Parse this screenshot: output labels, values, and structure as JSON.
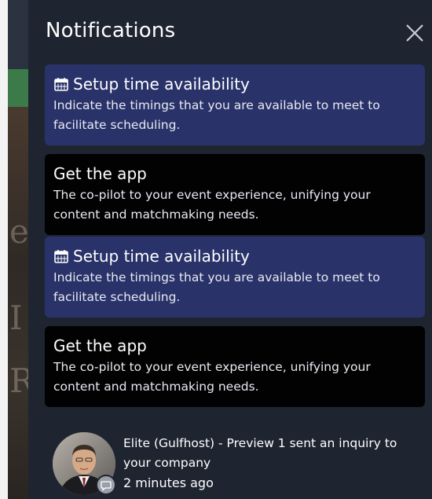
{
  "panel": {
    "title": "Notifications",
    "close_icon": "close-icon"
  },
  "notifications": [
    {
      "title": "Setup time availability",
      "body": "Indicate the timings that you are available to meet to facilitate scheduling.",
      "icon": "calendar-icon",
      "color": "#29336a"
    },
    {
      "title": "Get the app",
      "body": "The co-pilot to your event experience, unifying your content and matchmaking needs.",
      "color": "#020203"
    },
    {
      "title": "Setup time availability",
      "body": "Indicate the timings that you are available to meet to facilitate scheduling.",
      "icon": "calendar-icon",
      "color": "#29336a"
    },
    {
      "title": "Get the app",
      "body": "The co-pilot to your event experience, unifying your content and matchmaking needs.",
      "color": "#020203"
    }
  ],
  "inquiry": {
    "message": "Elite (Gulfhost) - Preview 1 sent an inquiry to your company",
    "time": "2 minutes ago",
    "badge_icon": "chat-icon"
  }
}
